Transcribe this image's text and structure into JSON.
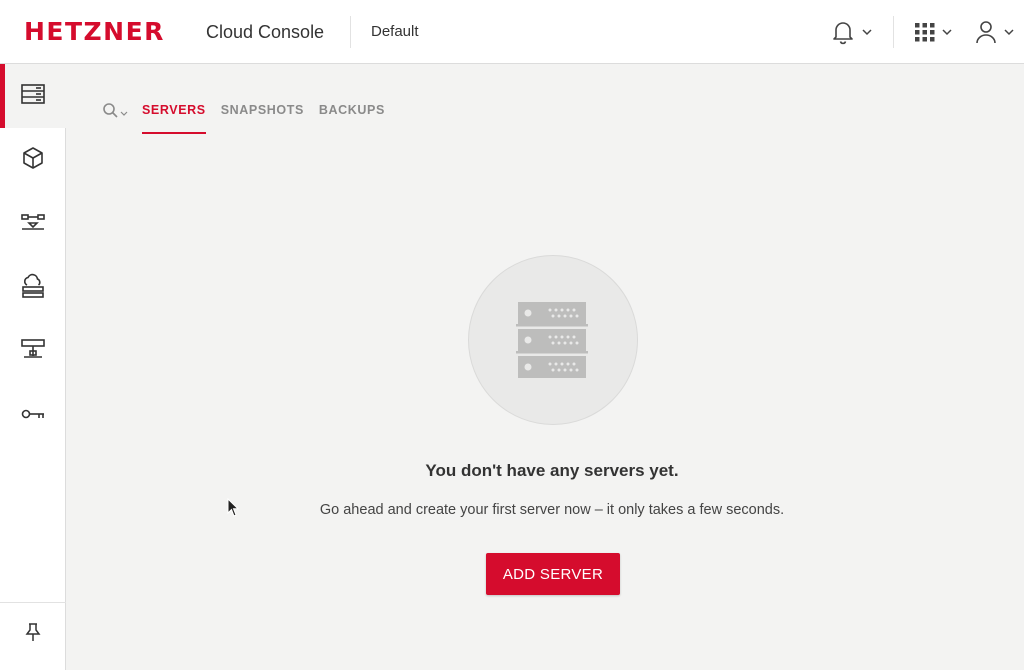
{
  "header": {
    "logo_text": "HETZNER",
    "app_name": "Cloud Console",
    "project_name": "Default",
    "icons": {
      "notifications": "bell-icon",
      "apps": "apps-grid-icon",
      "account": "user-icon",
      "dropdown": "chevron-down-icon"
    }
  },
  "sidebar": {
    "items": [
      {
        "name": "servers",
        "icon": "servers-icon",
        "active": true
      },
      {
        "name": "volumes",
        "icon": "cube-icon",
        "active": false
      },
      {
        "name": "load-balancers",
        "icon": "load-balancer-icon",
        "active": false
      },
      {
        "name": "floating-ips",
        "icon": "cloud-network-icon",
        "active": false
      },
      {
        "name": "networks",
        "icon": "network-icon",
        "active": false
      },
      {
        "name": "security",
        "icon": "key-icon",
        "active": false
      }
    ],
    "pin_icon": "pin-icon"
  },
  "tabs": {
    "search_icon": "search-icon",
    "items": [
      {
        "label": "SERVERS",
        "active": true
      },
      {
        "label": "SNAPSHOTS",
        "active": false
      },
      {
        "label": "BACKUPS",
        "active": false
      }
    ]
  },
  "empty_state": {
    "icon": "server-rack-icon",
    "title": "You don't have any servers yet.",
    "description": "Go ahead and create your first server now – it only takes a few seconds.",
    "button_label": "ADD SERVER"
  },
  "colors": {
    "brand": "#d50c2d",
    "background": "#f3f3f2",
    "text": "#333333",
    "muted": "#8a8a8a"
  }
}
